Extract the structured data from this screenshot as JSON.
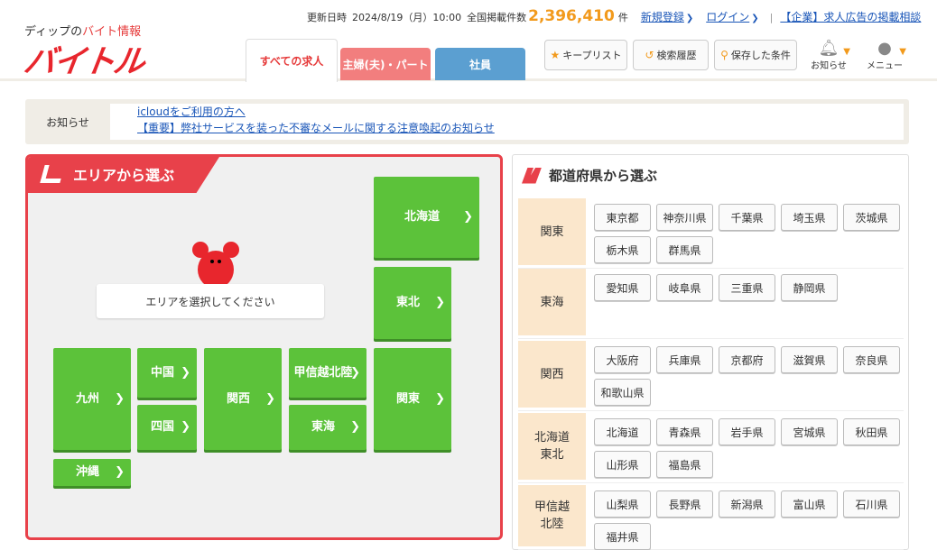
{
  "brand": {
    "tagline_pre": "ディップの",
    "tagline_red": "バイト情報",
    "logo": "バイトル"
  },
  "topbar": {
    "updated_label": "更新日時",
    "updated_value": "2024/8/19（月）10:00",
    "jobs_label": "全国掲載件数",
    "jobs_count": "2,396,410",
    "jobs_unit": "件",
    "register": "新規登録",
    "login": "ログイン",
    "corporate": "【企業】求人広告の掲載相談"
  },
  "tabs": {
    "all": "すべての求人",
    "part": "主婦(夫)・パート",
    "employee": "社員"
  },
  "header_buttons": {
    "keep": "キープリスト",
    "history": "検索履歴",
    "saved": "保存した条件",
    "notify": "お知らせ",
    "menu": "メニュー"
  },
  "notice": {
    "label": "お知らせ",
    "items": [
      "icloudをご利用の方へ",
      "【重要】弊社サービスを装った不審なメールに関する注意喚起のお知らせ"
    ]
  },
  "area_panel": {
    "title": "エリアから選ぶ",
    "prompt": "エリアを選択してください",
    "areas": {
      "hokkaido": "北海道",
      "tohoku": "東北",
      "kanto": "関東",
      "koshinetsu": "甲信越北陸",
      "tokai": "東海",
      "kansai": "関西",
      "chugoku": "中国",
      "shikoku": "四国",
      "kyushu": "九州",
      "okinawa": "沖縄"
    }
  },
  "pref_panel": {
    "title": "都道府県から選ぶ",
    "regions": [
      {
        "label": "関東",
        "prefs": [
          "東京都",
          "神奈川県",
          "千葉県",
          "埼玉県",
          "茨城県",
          "栃木県",
          "群馬県"
        ]
      },
      {
        "label": "東海",
        "prefs": [
          "愛知県",
          "岐阜県",
          "三重県",
          "静岡県"
        ]
      },
      {
        "label": "関西",
        "prefs": [
          "大阪府",
          "兵庫県",
          "京都府",
          "滋賀県",
          "奈良県",
          "和歌山県"
        ]
      },
      {
        "label": "北海道\n東北",
        "prefs": [
          "北海道",
          "青森県",
          "岩手県",
          "宮城県",
          "秋田県",
          "山形県",
          "福島県"
        ]
      },
      {
        "label": "甲信越\n北陸",
        "prefs": [
          "山梨県",
          "長野県",
          "新潟県",
          "富山県",
          "石川県",
          "福井県"
        ]
      }
    ]
  },
  "colors": {
    "brand_red": "#e8262d",
    "area_green": "#5cc23a",
    "link_blue": "#1a56b8",
    "count_orange": "#f29a1c",
    "part_tab": "#f27e7e",
    "employee_tab": "#5b9fd1"
  }
}
